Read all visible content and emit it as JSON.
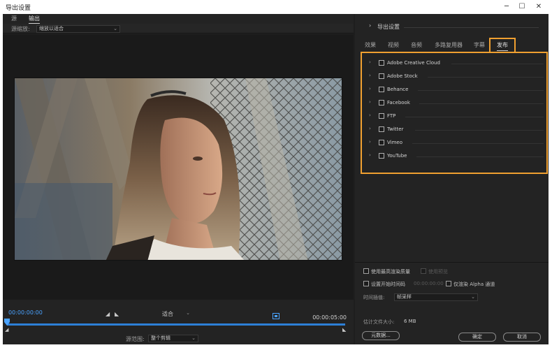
{
  "window": {
    "title": "导出设置",
    "controls": {
      "minimize": "─",
      "maximize": "☐",
      "close": "✕"
    }
  },
  "left_panel": {
    "tabs": [
      {
        "label": "源",
        "active": false
      },
      {
        "label": "输出",
        "active": true
      }
    ],
    "scale": {
      "label": "源缩放:",
      "value": "缩放以适合"
    },
    "timeline": {
      "current_time": "00:00:00:00",
      "end_time": "00:00:05:00",
      "fit_value": "适合",
      "progress": 1.0
    },
    "source_range": {
      "label": "源范围:",
      "value": "整个剪辑"
    }
  },
  "right_panel": {
    "section_title": "导出设置",
    "tabs": [
      {
        "label": "效果",
        "active": false
      },
      {
        "label": "视频",
        "active": false
      },
      {
        "label": "音频",
        "active": false
      },
      {
        "label": "多路复用器",
        "active": false
      },
      {
        "label": "字幕",
        "active": false
      },
      {
        "label": "发布",
        "active": true
      }
    ],
    "publish_items": [
      {
        "name": "Adobe Creative Cloud"
      },
      {
        "name": "Adobe Stock"
      },
      {
        "name": "Behance"
      },
      {
        "name": "Facebook"
      },
      {
        "name": "FTP"
      },
      {
        "name": "Twitter"
      },
      {
        "name": "Vimeo"
      },
      {
        "name": "YouTube"
      }
    ],
    "options": {
      "max_render_quality": "使用最高渲染质量",
      "use_previews": "使用预览",
      "set_start_timecode": "设置开始时间码",
      "start_timecode_value": "00:00:00:00",
      "render_alpha_only": "仅渲染 Alpha 通道",
      "time_interpolation_label": "时间插值:",
      "time_interpolation_value": "帧采样",
      "estimated_size_label": "估计文件大小:",
      "estimated_size_value": "6 MB"
    },
    "buttons": {
      "metadata": "元数据...",
      "ok": "确定",
      "cancel": "取消"
    }
  },
  "colors": {
    "accent_blue": "#2d7fd6",
    "highlight_orange": "#f0a030",
    "panel_bg": "#232323"
  }
}
